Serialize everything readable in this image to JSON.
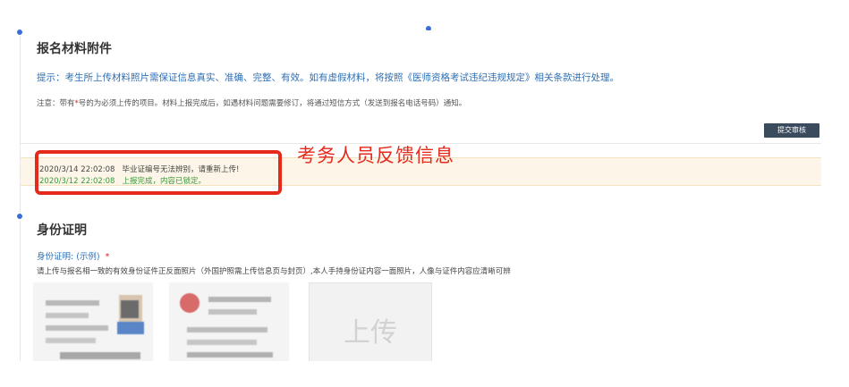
{
  "attachments": {
    "title": "报名材料附件",
    "tip": "提示：考生所上传材料照片需保证信息真实、准确、完整、有效。如有虚假材料，将按照《医师资格考试违纪违规规定》相关条款进行处理。",
    "note_prefix": "注意：带有",
    "note_star": "*",
    "note_suffix": "号的为必须上传的项目。材料上报完成后，如遇材料问题需要修订，将通过短信方式（发送到报名电话号码）通知。",
    "submit_button": "提交审核"
  },
  "feedback": {
    "annotation": "考务人员反馈信息",
    "entries": [
      {
        "time": "2020/3/14 22:02:08",
        "message": "毕业证编号无法辨别，请重新上传!"
      },
      {
        "time": "2020/3/12 22:02:08",
        "message": "上报完成，内容已锁定。"
      }
    ],
    "colors": {
      "error_text": "#444444",
      "success_text": "#3a9a3a",
      "highlight": "#e52a1c",
      "strip_bg": "#fdf6e8"
    }
  },
  "identity": {
    "title": "身份证明",
    "subtitle": "身份证明: (示例)",
    "required_mark": "*",
    "description": "请上传与报名相一致的有效身份证件正反面照片（外国护照需上传信息页与封页）,本人手持身份证内容一面照片，人像与证件内容应清晰可辨",
    "upload_label": "上传"
  }
}
